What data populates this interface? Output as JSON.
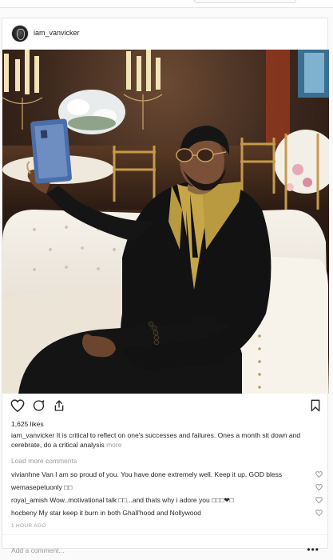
{
  "post": {
    "username": "iam_vanvicker",
    "likes": "1,625 likes",
    "caption": {
      "author": "iam_vanvicker",
      "text": "It is critical to reflect on one's successes and failures. Ones a month sit down and cerebrate, do a critical analysis",
      "more": "more"
    },
    "load_more": "Load more comments",
    "comments": [
      {
        "user": "vivianhne",
        "text": "Van I am so proud of you. You have done extremely well. Keep it up. GOD bless"
      },
      {
        "user": "wemasepetuonly",
        "text": "□□"
      },
      {
        "user": "royal_amish",
        "text": "Wow..motivational talk □□...and thats why i adore you □□□❤□"
      },
      {
        "user": "hocbeny",
        "text": "My star keep it burn in both Ghall'hood and Nollywood"
      }
    ],
    "time": "1 HOUR AGO",
    "add_comment_placeholder": "Add a comment...",
    "options_glyph": "•••"
  },
  "icons": {
    "like": "heart-icon",
    "comment": "comment-icon",
    "share": "share-icon",
    "save": "bookmark-icon",
    "options": "more-options-icon",
    "comment_like": "small-heart-icon"
  },
  "colors": {
    "text": "#262626",
    "muted": "#999999",
    "border": "#e6e6e6",
    "background": "#fafafa"
  }
}
